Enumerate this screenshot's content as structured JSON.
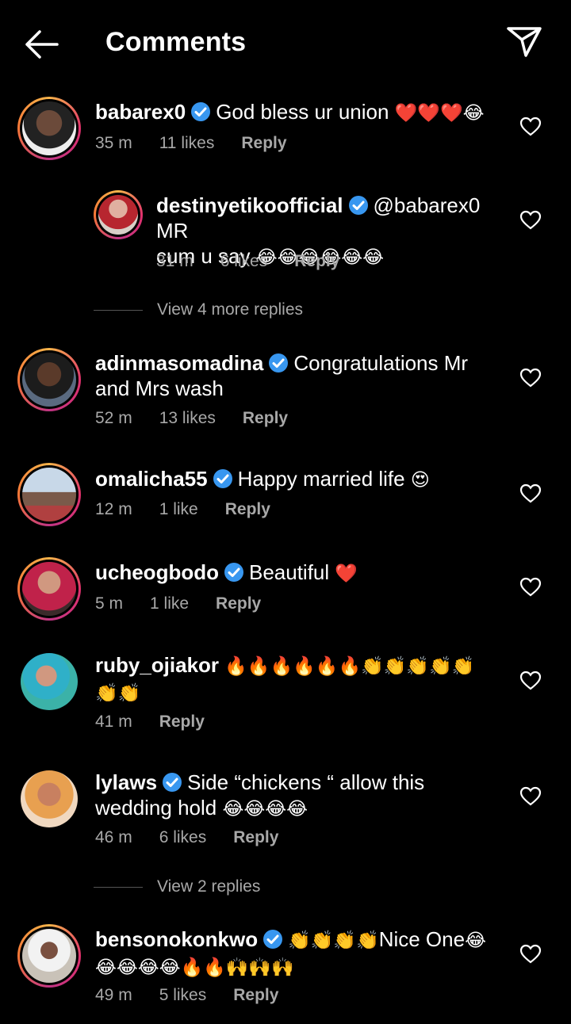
{
  "header": {
    "title": "Comments"
  },
  "comments": [
    {
      "user": "babarex0",
      "text": "God bless ur union",
      "emoji": "❤️❤️❤️😂",
      "time": "35 m",
      "likes": "11 likes",
      "reply": "Reply",
      "avatar_color": "#3a2a24"
    },
    {
      "user": "destinyetikoofficial",
      "text": "@babarex0 MR",
      "text2": "cum u say",
      "emoji": "😂😂😂😂😂😂",
      "time": "31 m",
      "likes": "6 likes",
      "reply": "Reply",
      "avatar_color": "#b7262f"
    },
    {
      "user": "adinmasomadina",
      "text": "Congratulations Mr",
      "text2": "and Mrs wash",
      "time": "52 m",
      "likes": "13 likes",
      "reply": "Reply",
      "avatar_color": "#5a6a80"
    },
    {
      "user": "omalicha55",
      "text": "Happy married life",
      "emoji": "😍",
      "time": "12 m",
      "likes": "1 like",
      "reply": "Reply",
      "avatar_color": "#8aa6c8"
    },
    {
      "user": "ucheogbodo",
      "text": "Beautiful",
      "emoji": "❤️",
      "time": "5 m",
      "likes": "1 like",
      "reply": "Reply",
      "avatar_color": "#c0224a"
    },
    {
      "user": "ruby_ojiakor",
      "emoji": "🔥🔥🔥🔥🔥🔥👏👏👏👏👏",
      "emoji2": "👏👏",
      "time": "41 m",
      "reply": "Reply",
      "avatar_color": "#3bb2a8"
    },
    {
      "user": "lylaws",
      "text": "Side “chickens “ allow this",
      "text2": "wedding hold",
      "emoji": "😂😂😂😂",
      "time": "46 m",
      "likes": "6 likes",
      "reply": "Reply",
      "avatar_color": "#d98a4a"
    },
    {
      "user": "bensonokonkwo",
      "emoji": "👏👏👏👏",
      "text": "Nice One",
      "emoji_after": "😂",
      "emoji2": "😂😂😂😂🔥🔥🙌🙌🙌",
      "time": "49 m",
      "likes": "5 likes",
      "reply": "Reply",
      "avatar_color": "#c9c2b8"
    }
  ],
  "view_more_1": "View 4 more replies",
  "view_more_2": "View 2 replies",
  "colors": {
    "verified": "#3897f0",
    "meta": "#a8a8a8",
    "background": "#000000"
  },
  "icons": [
    "back-arrow-icon",
    "send-icon",
    "verified-icon",
    "heart-icon"
  ]
}
